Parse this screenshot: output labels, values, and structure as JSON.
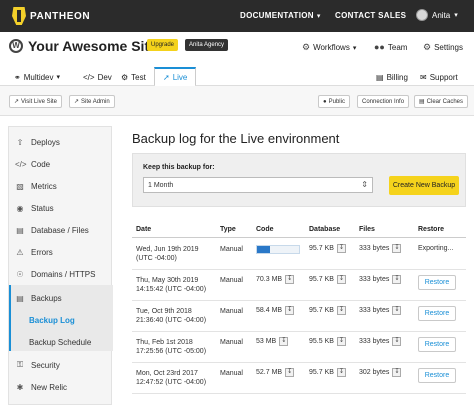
{
  "topbar": {
    "brand": "PANTHEON",
    "documentation": "DOCUMENTATION",
    "contact_sales": "CONTACT SALES",
    "user": "Anita"
  },
  "site": {
    "title": "Your Awesome Site",
    "upgrade_badge": "Upgrade",
    "agency_badge": "Anita Agency",
    "workflows": "Workflows",
    "team": "Team",
    "settings": "Settings"
  },
  "env_tabs": {
    "multidev": "Multidev",
    "dev": "Dev",
    "test": "Test",
    "live": "Live",
    "billing": "Billing",
    "support": "Support"
  },
  "toolbar": {
    "visit_live_site": "Visit Live Site",
    "site_admin": "Site Admin",
    "public": "Public",
    "connection_info": "Connection Info",
    "clear_caches": "Clear Caches"
  },
  "sidebar": {
    "items": [
      {
        "label": "Deploys",
        "icon": "cloud-upload-icon"
      },
      {
        "label": "Code",
        "icon": "code-icon"
      },
      {
        "label": "Metrics",
        "icon": "bar-chart-icon"
      },
      {
        "label": "Status",
        "icon": "status-icon"
      },
      {
        "label": "Database / Files",
        "icon": "database-icon"
      },
      {
        "label": "Errors",
        "icon": "errors-icon"
      },
      {
        "label": "Domains / HTTPS",
        "icon": "globe-icon"
      },
      {
        "label": "Backups",
        "icon": "backups-icon"
      },
      {
        "label": "Backup Log",
        "icon": ""
      },
      {
        "label": "Backup Schedule",
        "icon": ""
      },
      {
        "label": "Security",
        "icon": "lock-icon"
      },
      {
        "label": "New Relic",
        "icon": "new-relic-icon"
      }
    ]
  },
  "main": {
    "title": "Backup log for the Live environment",
    "keep_label": "Keep this backup for:",
    "keep_value": "1 Month",
    "create_button": "Create New Backup",
    "columns": [
      "Date",
      "Type",
      "Code",
      "Database",
      "Files",
      "Restore"
    ],
    "rows": [
      {
        "date_line1": "Wed, Jun 19th 2019",
        "date_line2": "(UTC -04:00)",
        "type": "Manual",
        "code": "",
        "code_progress": 0.3,
        "database": "95.7 KB",
        "files": "333 bytes",
        "restore": "Exporting..."
      },
      {
        "date_line1": "Thu, May 30th 2019",
        "date_line2": "14:15:42 (UTC -04:00)",
        "type": "Manual",
        "code": "70.3 MB",
        "database": "95.7 KB",
        "files": "333 bytes",
        "restore": "Restore"
      },
      {
        "date_line1": "Tue, Oct 9th 2018",
        "date_line2": "21:36:40 (UTC -04:00)",
        "type": "Manual",
        "code": "58.4 MB",
        "database": "95.7 KB",
        "files": "333 bytes",
        "restore": "Restore"
      },
      {
        "date_line1": "Thu, Feb 1st 2018",
        "date_line2": "17:25:56 (UTC -05:00)",
        "type": "Manual",
        "code": "53 MB",
        "database": "95.5 KB",
        "files": "333 bytes",
        "restore": "Restore"
      },
      {
        "date_line1": "Mon, Oct 23rd 2017",
        "date_line2": "12:47:52 (UTC -04:00)",
        "type": "Manual",
        "code": "52.7 MB",
        "database": "95.7 KB",
        "files": "302 bytes",
        "restore": "Restore"
      }
    ]
  }
}
